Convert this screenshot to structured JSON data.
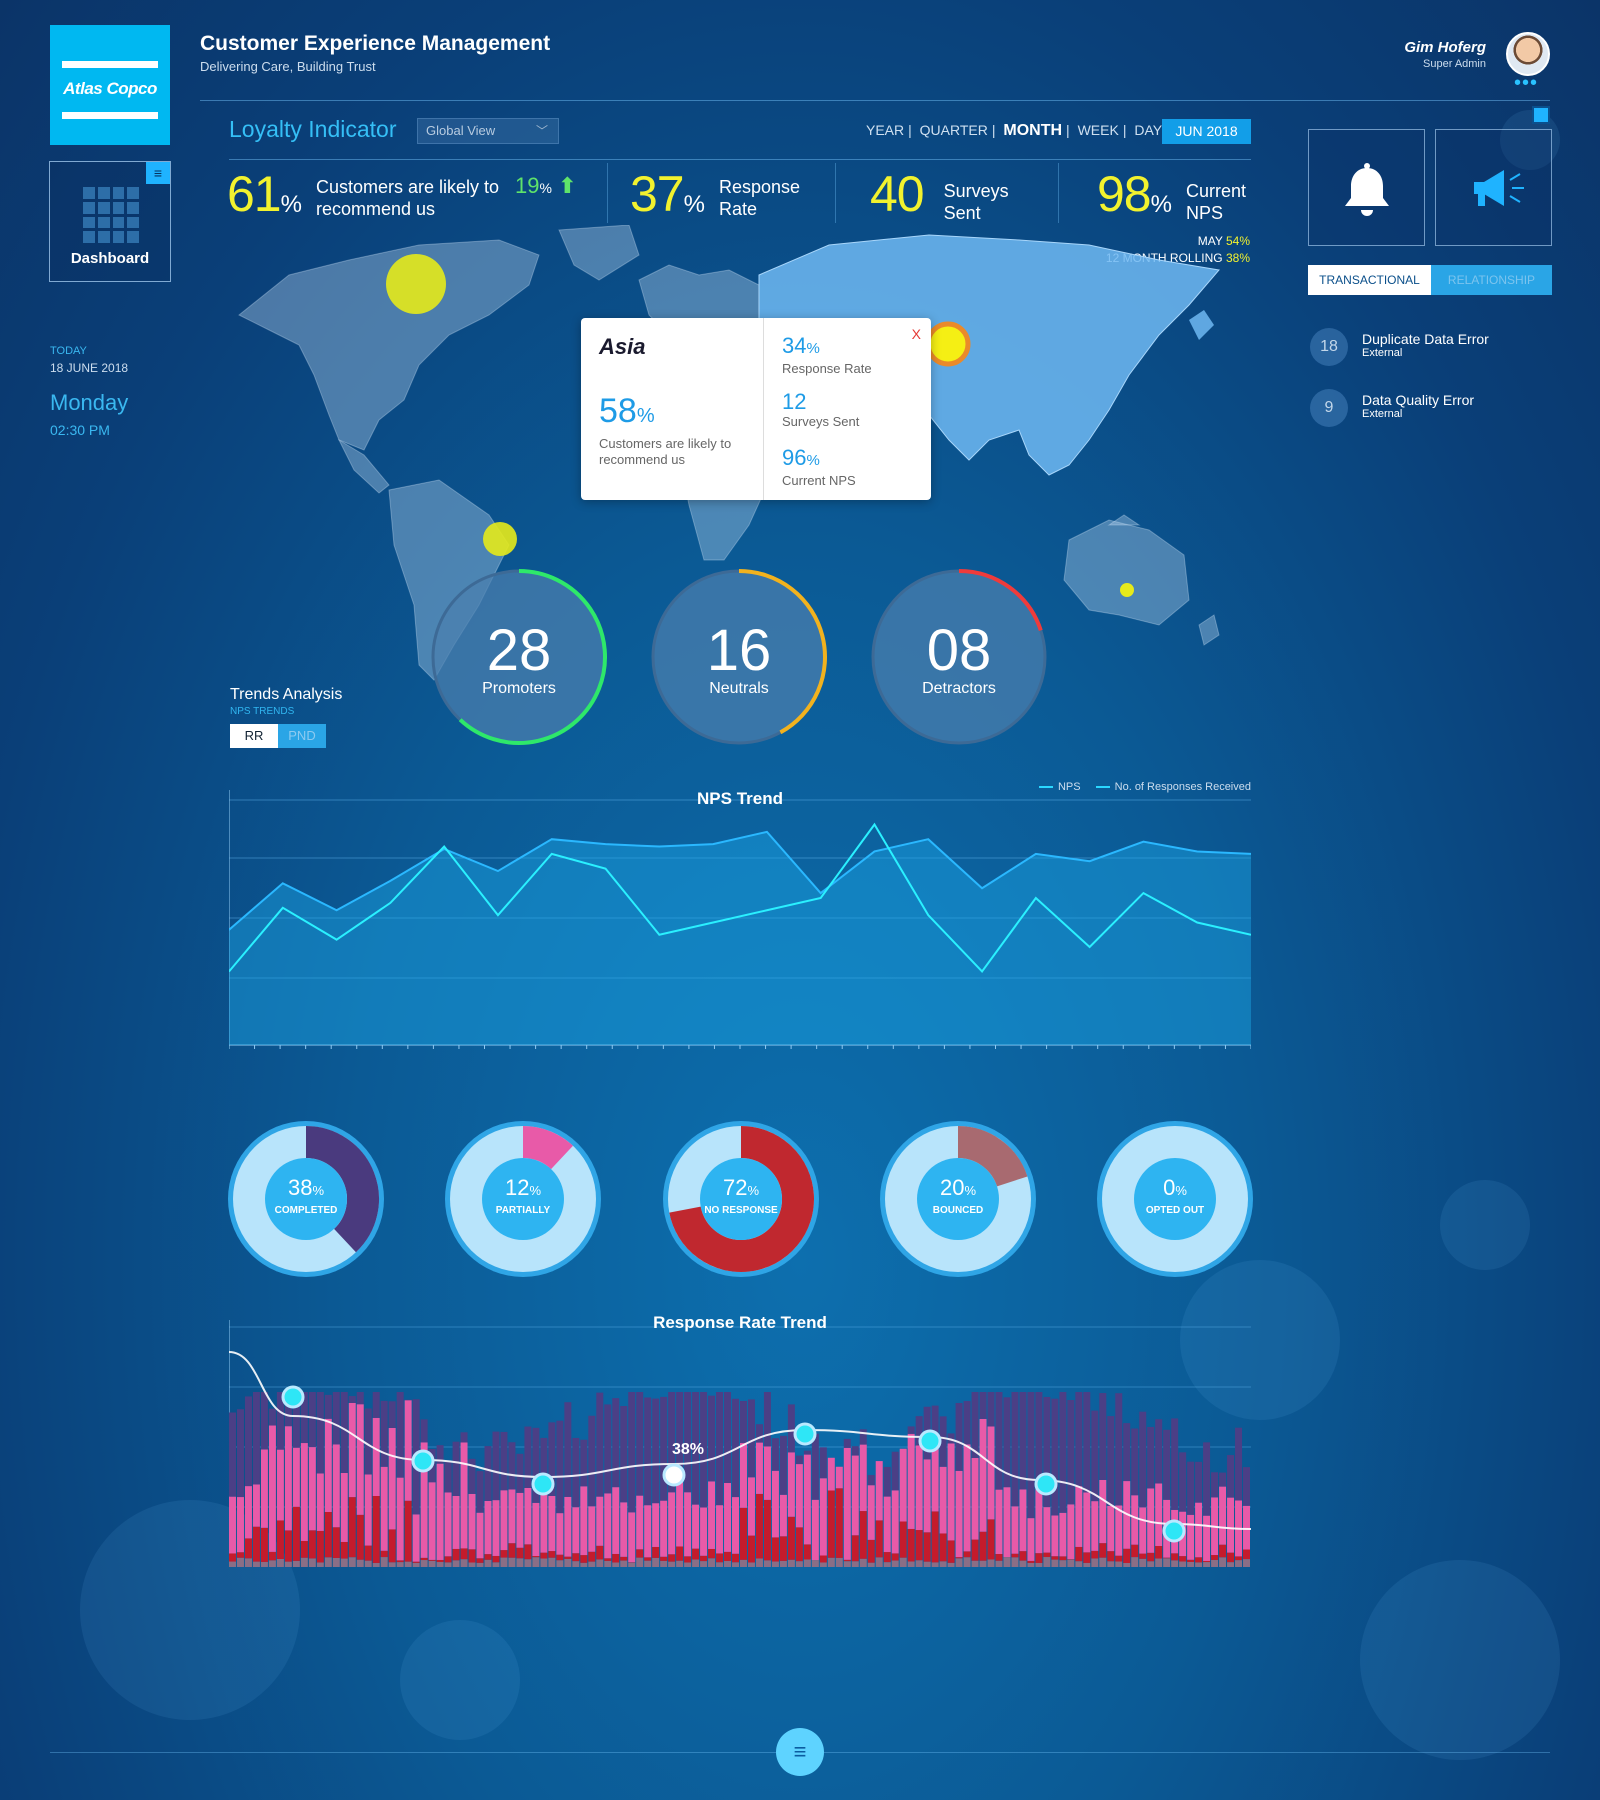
{
  "header": {
    "logo_text": "Atlas Copco",
    "title": "Customer Experience Management",
    "subtitle": "Delivering Care, Building Trust",
    "user_name": "Gim Hoferg",
    "user_role": "Super Admin"
  },
  "sidebar": {
    "dashboard_label": "Dashboard",
    "today_label": "TODAY",
    "date": "18 JUNE 2018",
    "weekday": "Monday",
    "time": "02:30 PM"
  },
  "loyalty": {
    "title": "Loyalty Indicator",
    "view_select": "Global View",
    "periods": [
      "YEAR",
      "QUARTER",
      "MONTH",
      "WEEK",
      "DAY"
    ],
    "active_period": "MONTH",
    "date_badge": "JUN 2018"
  },
  "kpis": {
    "recommend": {
      "value": "61",
      "unit": "%",
      "label_1": "Customers are likely to",
      "label_2": "recommend us",
      "change": "19",
      "change_unit": "%"
    },
    "response": {
      "value": "37",
      "unit": "%",
      "label_1": "Response",
      "label_2": "Rate"
    },
    "surveys": {
      "value": "40",
      "label_1": "Surveys",
      "label_2": "Sent"
    },
    "nps": {
      "value": "98",
      "unit": "%",
      "label_1": "Current",
      "label_2": "NPS"
    },
    "may_label": "MAY",
    "may_value": "54%",
    "rolling_label": "12 MONTH  ROLLING",
    "rolling_value": "38%"
  },
  "right_panel": {
    "tab_active": "TRANSACTIONAL",
    "tab_inactive": "RELATIONSHIP",
    "errors": [
      {
        "count": "18",
        "title": "Duplicate Data Error",
        "source": "External"
      },
      {
        "count": "9",
        "title": "Data Quality Error",
        "source": "External"
      }
    ]
  },
  "popup": {
    "region": "Asia",
    "recommend_value": "58",
    "recommend_unit": "%",
    "recommend_label": "Customers are likely to recommend us",
    "response_value": "34",
    "response_unit": "%",
    "response_label": "Response Rate",
    "surveys_value": "12",
    "surveys_label": "Surveys Sent",
    "nps_value": "96",
    "nps_unit": "%",
    "nps_label": "Current NPS",
    "close": "X"
  },
  "gauges": [
    {
      "value": "28",
      "label": "Promoters",
      "color": "#2ee86a",
      "fraction": 0.62
    },
    {
      "value": "16",
      "label": "Neutrals",
      "color": "#f2b21e",
      "fraction": 0.42
    },
    {
      "value": "08",
      "label": "Detractors",
      "color": "#ef3b3b",
      "fraction": 0.2
    }
  ],
  "trends": {
    "title": "Trends Analysis",
    "subtitle": "NPS TRENDS",
    "toggle_on": "RR",
    "toggle_off": "PND"
  },
  "chart_data": [
    {
      "type": "line",
      "title": "NPS Trend",
      "series": [
        {
          "name": "NPS",
          "values": [
            47,
            66,
            55,
            67,
            80,
            71,
            84,
            82,
            81,
            82,
            87,
            62,
            79,
            84,
            64,
            78,
            75,
            83,
            79,
            78
          ]
        },
        {
          "name": "No. of Responses Received",
          "values": [
            30,
            56,
            43,
            58,
            81,
            53,
            78,
            72,
            45,
            50,
            55,
            60,
            90,
            53,
            30,
            60,
            40,
            62,
            50,
            45
          ]
        }
      ]
    },
    {
      "type": "bar",
      "title": "Response Rate Trend",
      "peak_label": "38%",
      "trend_points": [
        66,
        45,
        35,
        33,
        36,
        48,
        47,
        28,
        12,
        9
      ]
    }
  ],
  "donuts": [
    {
      "value": "38",
      "unit": "%",
      "label": "COMPLETED",
      "fraction": 0.38,
      "color": "#4a3a7e"
    },
    {
      "value": "12",
      "unit": "%",
      "label": "PARTIALLY",
      "fraction": 0.12,
      "color": "#e85aa8"
    },
    {
      "value": "72",
      "unit": "%",
      "label": "NO RESPONSE",
      "fraction": 0.72,
      "color": "#c0282f"
    },
    {
      "value": "20",
      "unit": "%",
      "label": "BOUNCED",
      "fraction": 0.2,
      "color": "#a86a70"
    },
    {
      "value": "0",
      "unit": "%",
      "label": "OPTED OUT",
      "fraction": 0,
      "color": "#4a3a7e"
    }
  ]
}
